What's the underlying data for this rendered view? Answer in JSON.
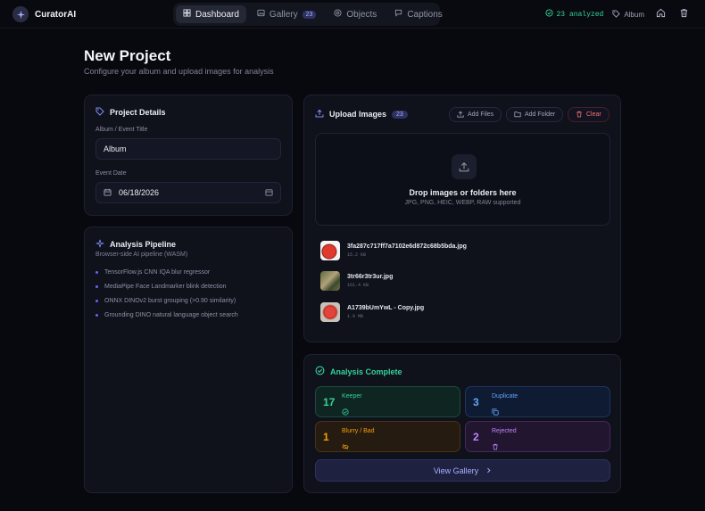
{
  "app": {
    "name": "CuratorAI"
  },
  "nav": {
    "tabs": [
      {
        "label": "Dashboard",
        "icon": "dashboard-icon",
        "active": true
      },
      {
        "label": "Gallery",
        "icon": "gallery-icon",
        "badge": "23"
      },
      {
        "label": "Objects",
        "icon": "objects-icon"
      },
      {
        "label": "Captions",
        "icon": "captions-icon"
      }
    ]
  },
  "header": {
    "analyzed": "23 analyzed",
    "album": "Album"
  },
  "page": {
    "title": "New Project",
    "subtitle": "Configure your album and upload images for analysis"
  },
  "project": {
    "title": "Project Details",
    "album_label": "Album / Event Title",
    "album_value": "Album",
    "date_label": "Event Date",
    "date_value": "06/18/2026"
  },
  "pipeline": {
    "title": "Analysis Pipeline",
    "subtitle": "Browser-side AI pipeline (WASM)",
    "items": [
      "TensorFlow.js CNN IQA blur regressor",
      "MediaPipe Face Landmarker blink detection",
      "ONNX DINOv2 burst grouping (>0.90 similarity)",
      "Grounding DINO natural language object search"
    ]
  },
  "upload": {
    "title": "Upload Images",
    "count": "23",
    "add_files": "Add Files",
    "add_folder": "Add Folder",
    "clear": "Clear",
    "drop_title": "Drop images or folders here",
    "drop_sub": "JPG, PNG, HEIC, WEBP, RAW supported",
    "files": [
      {
        "name": "3fa287c717ff7a7102e6d872c68b5bda.jpg",
        "size": "15.2 KB"
      },
      {
        "name": "3tr66r3tr3ur.jpg",
        "size": "161.4 KB"
      },
      {
        "name": "A1739bUmYwL - Copy.jpg",
        "size": "1.0 MB"
      }
    ]
  },
  "analysis": {
    "title": "Analysis Complete",
    "stats": [
      {
        "count": "17",
        "label": "Keeper",
        "color": "#34d399"
      },
      {
        "count": "3",
        "label": "Duplicate",
        "color": "#60a5fa"
      },
      {
        "count": "1",
        "label": "Blurry / Bad",
        "color": "#f59e0b"
      },
      {
        "count": "2",
        "label": "Rejected",
        "color": "#c084fc"
      }
    ],
    "view_gallery": "View Gallery"
  }
}
